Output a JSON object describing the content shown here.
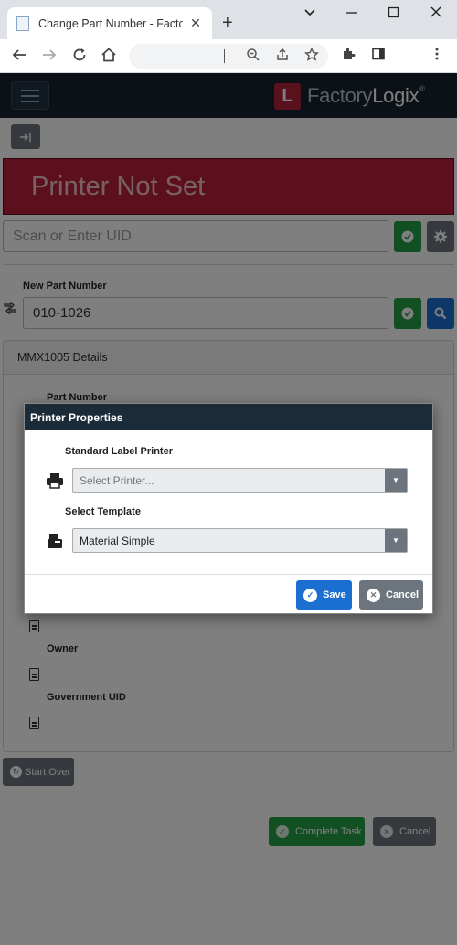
{
  "browser": {
    "tab_title": "Change Part Number - FactoryLogix",
    "tab_close": "✕",
    "new_tab": "+"
  },
  "app": {
    "logo_letter": "L",
    "logo_text_part1": "Factory",
    "logo_text_part2": "Logix",
    "logo_reg": "®"
  },
  "banner": {
    "text": "Printer Not Set"
  },
  "uid": {
    "placeholder": "Scan or Enter UID"
  },
  "new_part": {
    "label": "New Part Number",
    "value": "010-1026"
  },
  "details": {
    "header": "MMX1005 Details",
    "fields": [
      {
        "label": "Part Number"
      },
      {
        "label": "Owner"
      },
      {
        "label": "Government UID"
      }
    ]
  },
  "buttons": {
    "start_over": "Start Over",
    "complete_task": "Complete Task",
    "cancel": "Cancel"
  },
  "modal": {
    "title": "Printer Properties",
    "printer_label": "Standard Label Printer",
    "printer_placeholder": "Select Printer...",
    "template_label": "Select Template",
    "template_value": "Material Simple",
    "save": "Save",
    "cancel": "Cancel"
  },
  "colors": {
    "banner": "#b8203a",
    "primary": "#1a6fd0",
    "success": "#24a148",
    "secondary": "#6c757d",
    "header": "#17232d"
  }
}
